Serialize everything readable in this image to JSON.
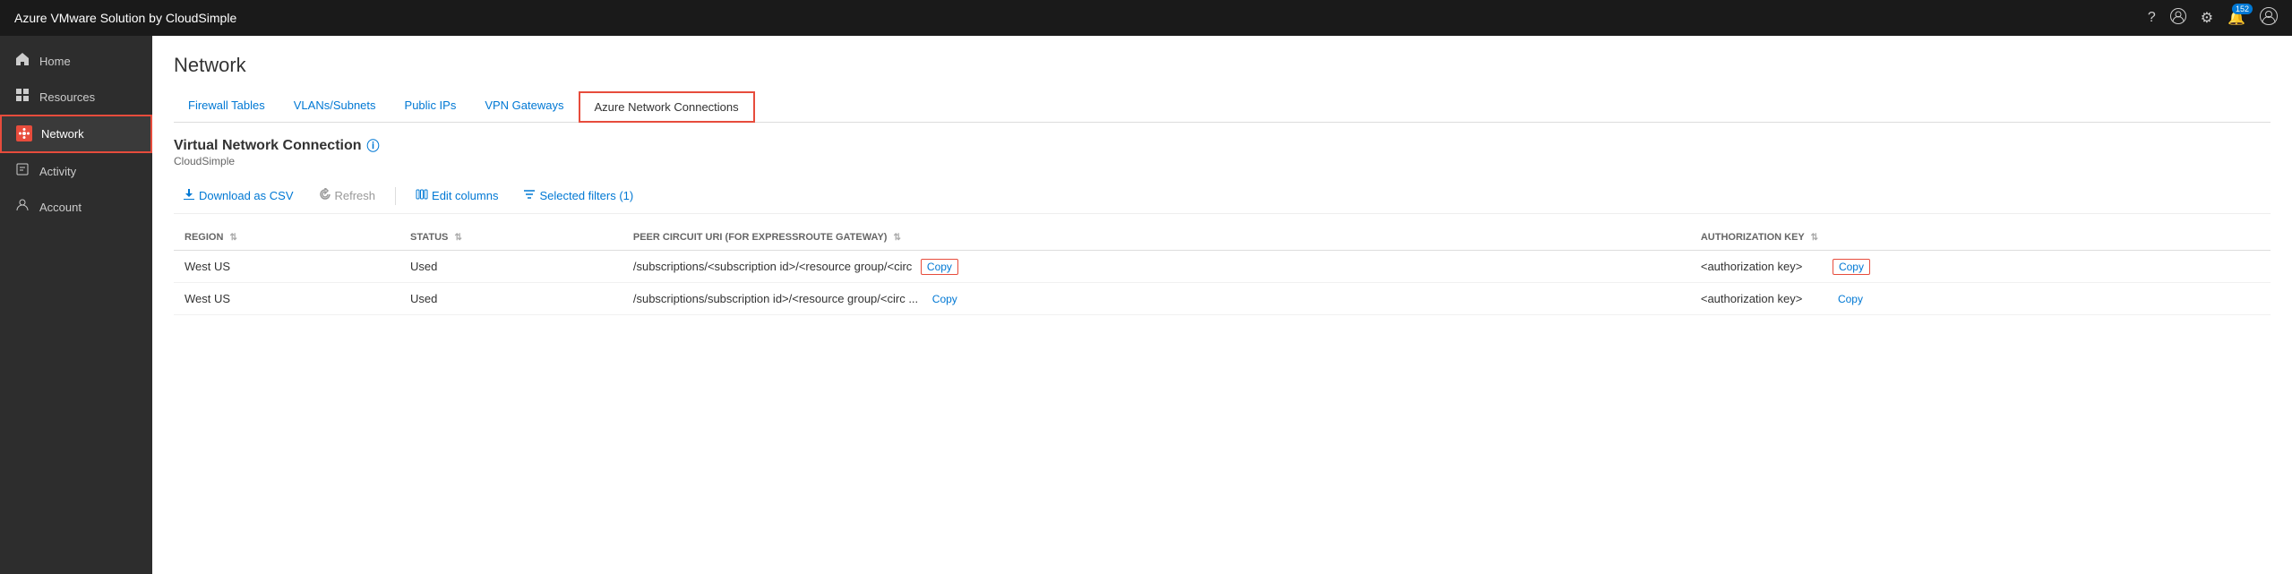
{
  "app": {
    "title": "Azure VMware Solution by CloudSimple"
  },
  "header_icons": {
    "help": "?",
    "user_circle": "👤",
    "settings": "⚙",
    "notifications": "🔔",
    "notification_count": "152",
    "profile": "👤"
  },
  "sidebar": {
    "items": [
      {
        "id": "home",
        "label": "Home",
        "icon": "🏠",
        "active": false
      },
      {
        "id": "resources",
        "label": "Resources",
        "icon": "⊞",
        "active": false
      },
      {
        "id": "network",
        "label": "Network",
        "icon": "🌐",
        "active": true,
        "highlighted": true
      },
      {
        "id": "activity",
        "label": "Activity",
        "icon": "📋",
        "active": false
      },
      {
        "id": "account",
        "label": "Account",
        "icon": "👤",
        "active": false
      }
    ]
  },
  "page": {
    "title": "Network"
  },
  "tabs": [
    {
      "id": "firewall-tables",
      "label": "Firewall Tables",
      "active": false
    },
    {
      "id": "vlans-subnets",
      "label": "VLANs/Subnets",
      "active": false
    },
    {
      "id": "public-ips",
      "label": "Public IPs",
      "active": false
    },
    {
      "id": "vpn-gateways",
      "label": "VPN Gateways",
      "active": false
    },
    {
      "id": "azure-network-connections",
      "label": "Azure Network Connections",
      "active": true,
      "highlighted": true
    }
  ],
  "section": {
    "title": "Virtual Network Connection",
    "subtitle": "CloudSimple",
    "info_tooltip": "ⓘ"
  },
  "toolbar": {
    "download_csv": "Download as CSV",
    "refresh": "Refresh",
    "edit_columns": "Edit columns",
    "selected_filters": "Selected filters (1)"
  },
  "table": {
    "columns": [
      {
        "id": "region",
        "label": "REGION"
      },
      {
        "id": "status",
        "label": "STATUS"
      },
      {
        "id": "peer_circuit_uri",
        "label": "PEER CIRCUIT URI (FOR EXPRESSROUTE GATEWAY)"
      },
      {
        "id": "authorization_key",
        "label": "AUTHORIZATION KEY"
      }
    ],
    "rows": [
      {
        "region": "West US",
        "status": "Used",
        "peer_circuit_uri": "/subscriptions/<subscription id>/<resource group/<circ",
        "peer_circuit_copy": "Copy",
        "peer_circuit_copy_highlighted": true,
        "authorization_key": "<authorization key>",
        "auth_key_copy": "Copy",
        "auth_key_copy_highlighted": true
      },
      {
        "region": "West US",
        "status": "Used",
        "peer_circuit_uri": "/subscriptions/subscription id>/<resource group/<circ ...",
        "peer_circuit_copy": "Copy",
        "peer_circuit_copy_highlighted": false,
        "authorization_key": "<authorization key>",
        "auth_key_copy": "Copy",
        "auth_key_copy_highlighted": false
      }
    ]
  }
}
